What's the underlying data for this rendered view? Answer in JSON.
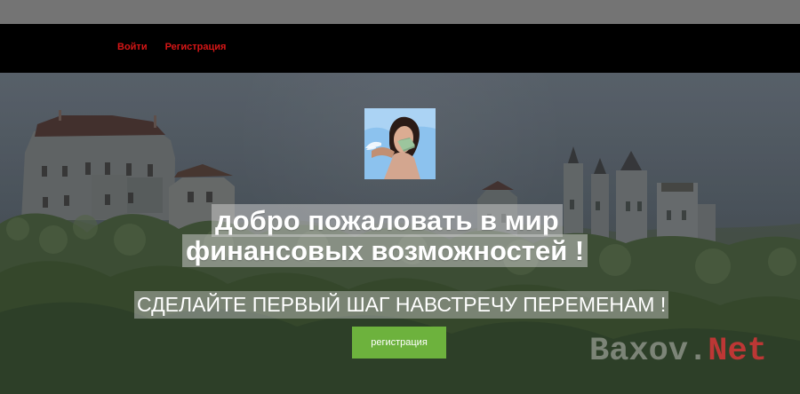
{
  "nav": {
    "login": "Войти",
    "register": "Регистрация"
  },
  "hero": {
    "title_line1": "добро пожаловать в мир",
    "title_line2": "финансовых возможностей !",
    "subtitle": "СДЕЛАЙТЕ ПЕРВЫЙ ШАГ НАВСТРЕЧУ ПЕРЕМЕНАМ !",
    "button": "регистрация"
  },
  "watermark": {
    "part1": "Baxov.",
    "part2": "Net"
  },
  "colors": {
    "nav_link": "#d61616",
    "button": "#6db23d",
    "background": "#000000"
  }
}
